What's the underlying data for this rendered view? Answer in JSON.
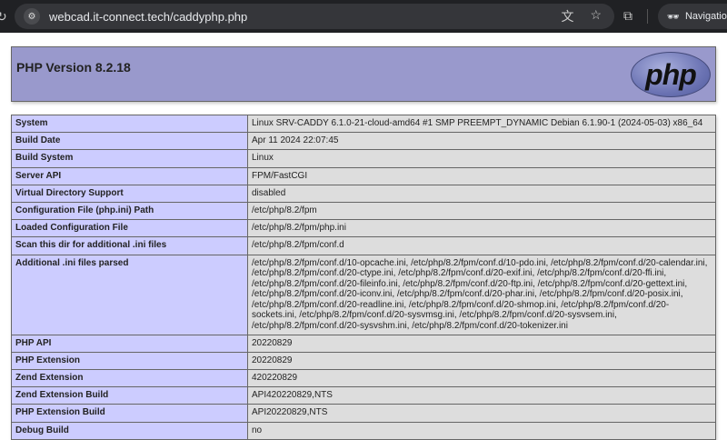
{
  "browser": {
    "url": "webcad.it-connect.tech/caddyphp.php",
    "navigation_label": "Navigation"
  },
  "header": {
    "title": "PHP Version 8.2.18",
    "logo_text": "php"
  },
  "rows": [
    {
      "label": "System",
      "value": "Linux SRV-CADDY 6.1.0-21-cloud-amd64 #1 SMP PREEMPT_DYNAMIC Debian 6.1.90-1 (2024-05-03) x86_64"
    },
    {
      "label": "Build Date",
      "value": "Apr 11 2024 22:07:45"
    },
    {
      "label": "Build System",
      "value": "Linux"
    },
    {
      "label": "Server API",
      "value": "FPM/FastCGI"
    },
    {
      "label": "Virtual Directory Support",
      "value": "disabled"
    },
    {
      "label": "Configuration File (php.ini) Path",
      "value": "/etc/php/8.2/fpm"
    },
    {
      "label": "Loaded Configuration File",
      "value": "/etc/php/8.2/fpm/php.ini"
    },
    {
      "label": "Scan this dir for additional .ini files",
      "value": "/etc/php/8.2/fpm/conf.d"
    },
    {
      "label": "Additional .ini files parsed",
      "value": "/etc/php/8.2/fpm/conf.d/10-opcache.ini, /etc/php/8.2/fpm/conf.d/10-pdo.ini, /etc/php/8.2/fpm/conf.d/20-calendar.ini, /etc/php/8.2/fpm/conf.d/20-ctype.ini, /etc/php/8.2/fpm/conf.d/20-exif.ini, /etc/php/8.2/fpm/conf.d/20-ffi.ini, /etc/php/8.2/fpm/conf.d/20-fileinfo.ini, /etc/php/8.2/fpm/conf.d/20-ftp.ini, /etc/php/8.2/fpm/conf.d/20-gettext.ini, /etc/php/8.2/fpm/conf.d/20-iconv.ini, /etc/php/8.2/fpm/conf.d/20-phar.ini, /etc/php/8.2/fpm/conf.d/20-posix.ini, /etc/php/8.2/fpm/conf.d/20-readline.ini, /etc/php/8.2/fpm/conf.d/20-shmop.ini, /etc/php/8.2/fpm/conf.d/20-sockets.ini, /etc/php/8.2/fpm/conf.d/20-sysvmsg.ini, /etc/php/8.2/fpm/conf.d/20-sysvsem.ini, /etc/php/8.2/fpm/conf.d/20-sysvshm.ini, /etc/php/8.2/fpm/conf.d/20-tokenizer.ini"
    },
    {
      "label": "PHP API",
      "value": "20220829"
    },
    {
      "label": "PHP Extension",
      "value": "20220829"
    },
    {
      "label": "Zend Extension",
      "value": "420220829"
    },
    {
      "label": "Zend Extension Build",
      "value": "API420220829,NTS"
    },
    {
      "label": "PHP Extension Build",
      "value": "API20220829,NTS"
    },
    {
      "label": "Debug Build",
      "value": "no"
    }
  ]
}
